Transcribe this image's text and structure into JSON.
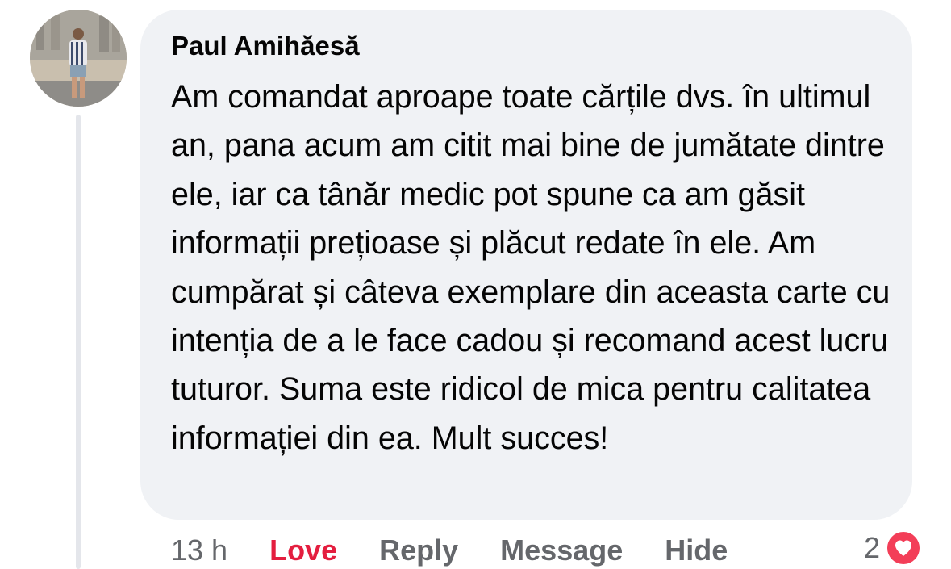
{
  "comment": {
    "author": "Paul Amihăesă",
    "text": "Am comandat aproape toate cărțile dvs. în ultimul an, pana acum am citit mai bine de jumătate dintre ele, iar ca tânăr medic pot spune ca am găsit informații prețioase și plăcut redate în ele. Am cumpărat și câteva exemplare din aceasta carte cu intenția de a le face cadou și recomand acest lucru tuturor. Suma este ridicol de mica pentru calitatea informației din ea. Mult succes!",
    "timestamp": "13 h",
    "reaction_count": "2",
    "reaction_icon": "heart-icon"
  },
  "actions": {
    "love": "Love",
    "reply": "Reply",
    "message": "Message",
    "hide": "Hide"
  },
  "colors": {
    "bubble": "#f0f2f5",
    "love": "#e41e3f",
    "secondary_text": "#65676b",
    "heart_badge": "#f33e58"
  }
}
